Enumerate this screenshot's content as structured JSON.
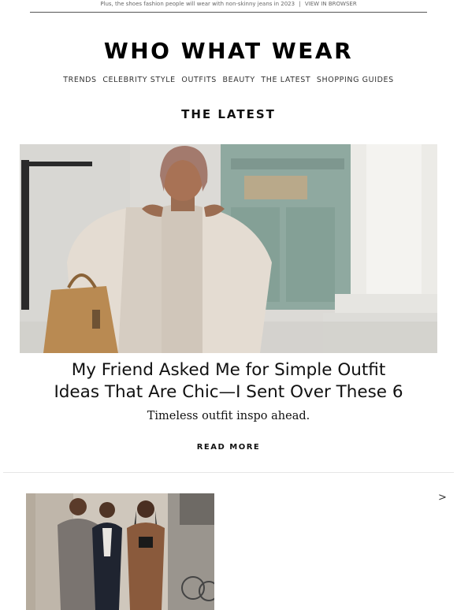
{
  "preheader": {
    "text": "Plus, the shoes fashion people will wear with non-skinny jeans in 2023",
    "separator": "|",
    "link": "VIEW IN BROWSER"
  },
  "brand": {
    "logo": "WHO WHAT WEAR"
  },
  "nav": {
    "items": [
      "TRENDS",
      "CELEBRITY STYLE",
      "OUTFITS",
      "BEAUTY",
      "THE LATEST",
      "SHOPPING GUIDES"
    ]
  },
  "section": {
    "title": "THE LATEST"
  },
  "feature": {
    "headline_line1": "My Friend Asked Me for Simple Outfit",
    "headline_line2": "Ideas That Are Chic—I Sent Over These 6",
    "dek": "Timeless outfit inspo ahead.",
    "cta": "READ MORE"
  },
  "next_story": {
    "arrow": ">"
  },
  "colors": {
    "text": "#111111",
    "divider": "#e6e6e6",
    "muted": "#666666"
  }
}
